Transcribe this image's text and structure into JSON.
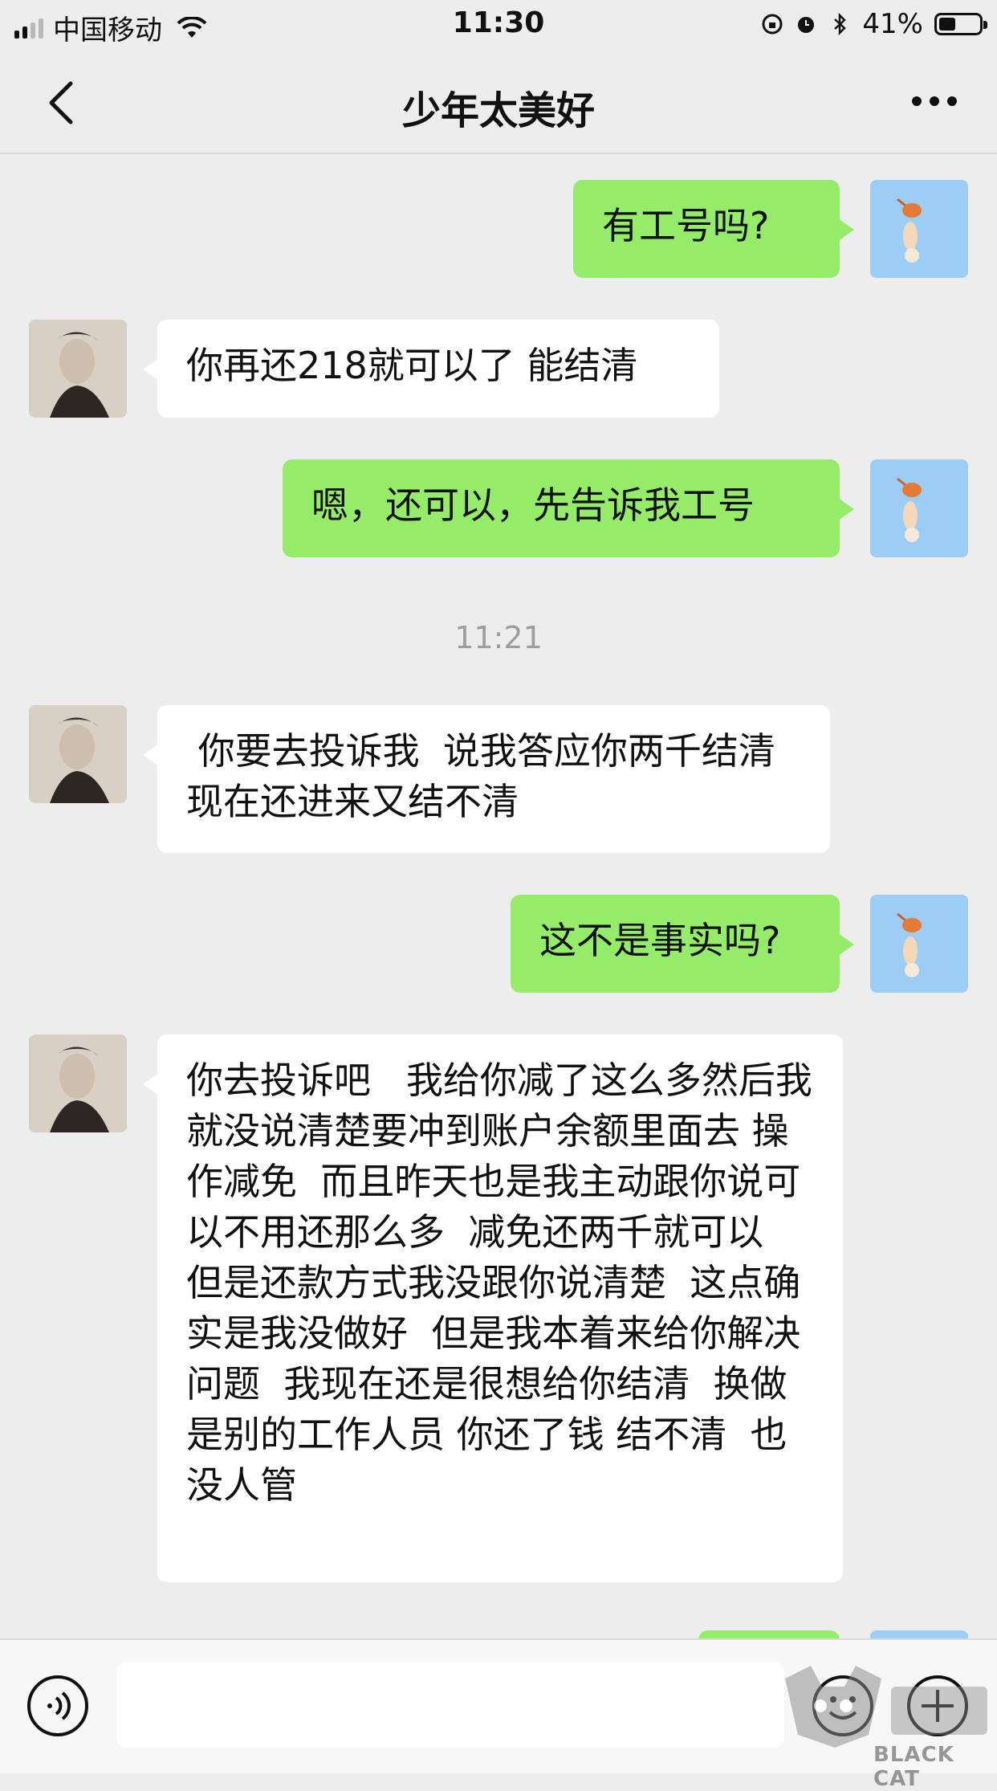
{
  "status_bar": {
    "carrier": "中国移动",
    "time": "11:30",
    "battery": "41%",
    "battery_level": 0.41
  },
  "navbar": {
    "title": "少年太美好"
  },
  "timestamp": "11:21",
  "messages": [
    {
      "from": "me",
      "text": "有工号吗?"
    },
    {
      "from": "them",
      "text": "你再还218就可以了  能结清"
    },
    {
      "from": "me",
      "text": "嗯，还可以，先告诉我工号"
    },
    {
      "from": "them",
      "text": " 你要去投诉我  说我答应你两千结清  现在还进来又结不清"
    },
    {
      "from": "me",
      "text": "这不是事实吗?"
    },
    {
      "from": "them",
      "text": "你去投诉吧   我给你减了这么多然后我就没说清楚要冲到账户余额里面去 操作减免  而且昨天也是我主动跟你说可以不用还那么多  减免还两千就可以  但是还款方式我没跟你说清楚  这点确实是我没做好  但是我本着来给你解决问题  我现在还是很想给你结清  换做是别的工作人员 你还了钱 结不清  也没人管"
    }
  ],
  "input_bar": {
    "value": ""
  },
  "watermark": {
    "text": "BLACK CAT"
  },
  "icons": {
    "back": "chevron-left-icon",
    "more": "more-dots-icon",
    "voice": "voice-icon",
    "emoji": "emoji-icon",
    "plus": "plus-icon"
  }
}
